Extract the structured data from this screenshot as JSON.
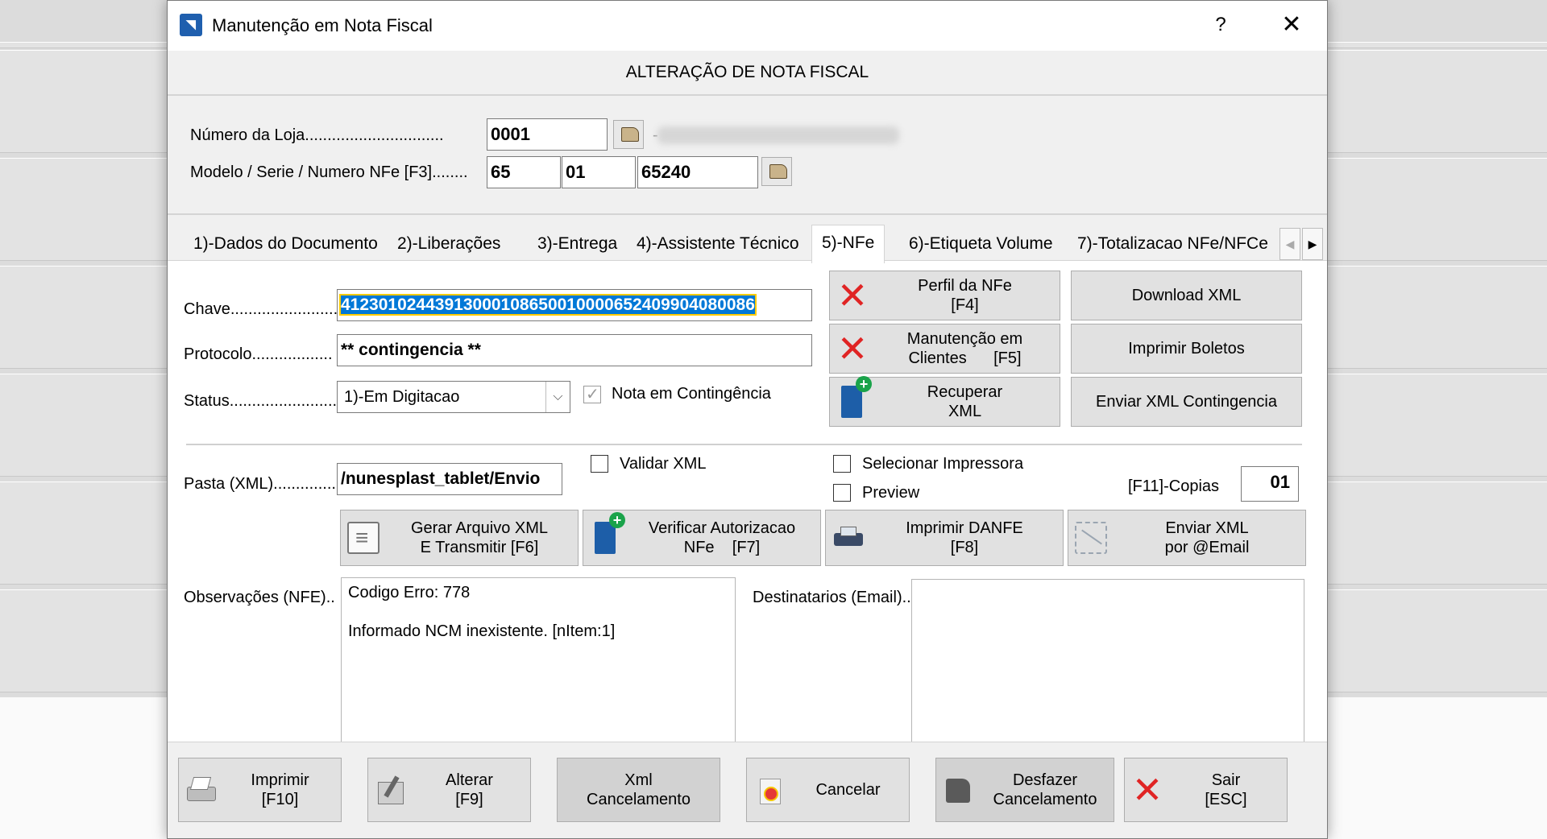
{
  "window": {
    "title": "Manutenção em Nota Fiscal",
    "help": "?",
    "close": "✕"
  },
  "header": {
    "title": "ALTERAÇÃO DE NOTA FISCAL"
  },
  "loja": {
    "label": "Número da Loja...............................",
    "value": "0001",
    "name_separator": "-"
  },
  "modelo": {
    "label": "Modelo / Serie / Numero NFe [F3]........",
    "modelo": "65",
    "serie": "01",
    "numero": "65240"
  },
  "tabs": [
    {
      "label": "1)-Dados do Documento"
    },
    {
      "label": "2)-Liberações"
    },
    {
      "label": "3)-Entrega"
    },
    {
      "label": "4)-Assistente Técnico"
    },
    {
      "label": "5)-NFe"
    },
    {
      "label": "6)-Etiqueta Volume"
    },
    {
      "label": "7)-Totalizacao NFe/NFCe"
    }
  ],
  "active_tab": "5)-NFe",
  "nfe": {
    "chave_label": "Chave.........................",
    "chave_value": "41230102443913000108650010000652409904080086",
    "protocolo_label": "Protocolo..................",
    "protocolo_value": "** contingencia **",
    "status_label": "Status.........................",
    "status_value": "1)-Em Digitacao",
    "contingencia_label": "Nota em Contingência",
    "contingencia_checked": true,
    "pasta_label": "Pasta (XML)..............",
    "pasta_value": "/nunesplast_tablet/Envio",
    "validar_label": "Validar XML",
    "selecionar_label": "Selecionar Impressora",
    "preview_label": "Preview",
    "copias_label": "[F11]-Copias",
    "copias_value": "01",
    "obs_label": "Observações (NFE)..",
    "obs_line1": "Codigo Erro: 778",
    "obs_line2": "Informado NCM inexistente. [nItem:1]",
    "dest_label": "Destinatarios (Email).."
  },
  "actions": {
    "perfil": "Perfil da NFe\n[F4]",
    "download": "Download XML",
    "manutencao": "Manutenção em\nClientes      [F5]",
    "boletos": "Imprimir Boletos",
    "recuperar": "Recuperar\nXML",
    "enviar_cont": "Enviar XML Contingencia",
    "gerar": "Gerar Arquivo XML\nE Transmitir [F6]",
    "verificar": "Verificar Autorizacao\nNFe    [F7]",
    "danfe": "Imprimir DANFE\n[F8]",
    "email": "Enviar XML\npor @Email"
  },
  "bottom": {
    "imprimir": "Imprimir\n[F10]",
    "alterar": "Alterar\n[F9]",
    "xml_cancel": "Xml\nCancelamento",
    "cancelar": "Cancelar",
    "desfazer": "Desfazer\nCancelamento",
    "sair": "Sair\n[ESC]"
  },
  "colors": {
    "selection": "#0078d7",
    "focus_outline": "#ffcc00",
    "error_red": "#e02424"
  }
}
